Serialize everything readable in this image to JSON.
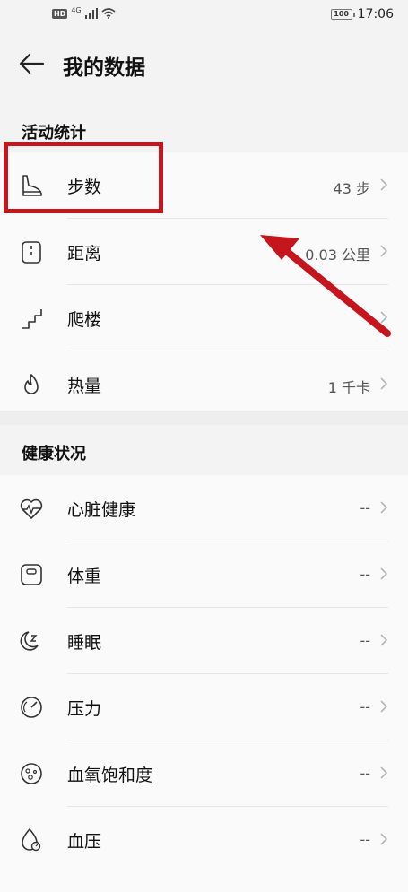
{
  "status_bar": {
    "hd_badge": "HD",
    "network": "4G",
    "battery": "100",
    "time": "17:06"
  },
  "header": {
    "title": "我的数据",
    "back_icon": "back-arrow-icon"
  },
  "activity": {
    "section_title": "活动统计",
    "items": [
      {
        "label": "步数",
        "value": "43 步",
        "icon": "footprint-icon"
      },
      {
        "label": "距离",
        "value": "0.03 公里",
        "icon": "distance-icon"
      },
      {
        "label": "爬楼",
        "value": "",
        "icon": "stairs-icon"
      },
      {
        "label": "热量",
        "value": "1 千卡",
        "icon": "calorie-flame-icon"
      }
    ]
  },
  "health": {
    "section_title": "健康状况",
    "items": [
      {
        "label": "心脏健康",
        "value": "--",
        "icon": "heart-rate-icon"
      },
      {
        "label": "体重",
        "value": "--",
        "icon": "weight-scale-icon"
      },
      {
        "label": "睡眠",
        "value": "--",
        "icon": "sleep-moon-icon"
      },
      {
        "label": "压力",
        "value": "--",
        "icon": "pressure-gauge-icon"
      },
      {
        "label": "血氧饱和度",
        "value": "--",
        "icon": "blood-oxygen-icon"
      },
      {
        "label": "血压",
        "value": "--",
        "icon": "blood-pressure-drop-icon"
      }
    ]
  },
  "colors": {
    "annotation": "#c4161c",
    "background": "#f3f3f3",
    "divider": "#e6e6e6"
  }
}
